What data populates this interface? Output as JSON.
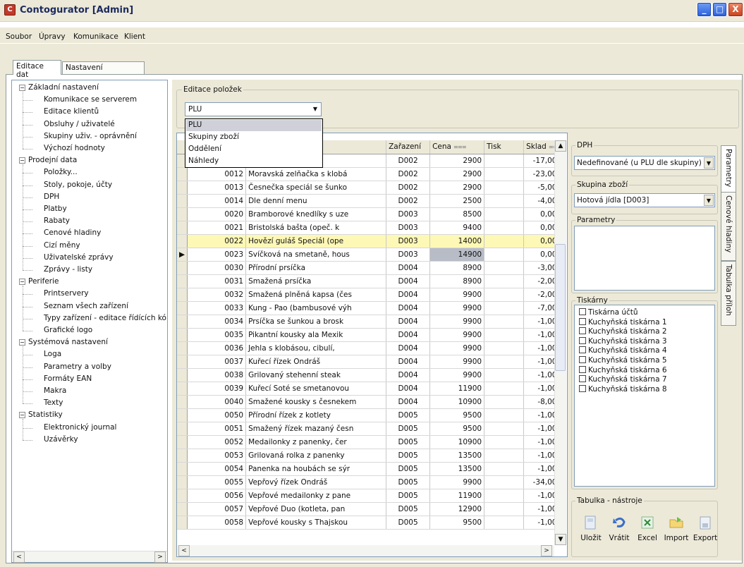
{
  "window": {
    "title": "Contogurator [Admin]",
    "buttons": [
      "_",
      "□",
      "X"
    ]
  },
  "menu": [
    "Soubor",
    "Úpravy",
    "Komunikace",
    "Klient"
  ],
  "tabs": [
    "Editace dat",
    "Nastavení programu"
  ],
  "tree": [
    {
      "label": "Základní nastavení",
      "level": 0
    },
    {
      "label": "Komunikace se serverem",
      "level": 1
    },
    {
      "label": "Editace klientů",
      "level": 1
    },
    {
      "label": "Obsluhy / uživatelé",
      "level": 1
    },
    {
      "label": "Skupiny uživ. - oprávnění",
      "level": 1
    },
    {
      "label": "Výchozí hodnoty",
      "level": 1
    },
    {
      "label": "Prodejní data",
      "level": 0
    },
    {
      "label": "Položky...",
      "level": 1
    },
    {
      "label": "Stoly, pokoje, účty",
      "level": 1
    },
    {
      "label": "DPH",
      "level": 1
    },
    {
      "label": "Platby",
      "level": 1
    },
    {
      "label": "Rabaty",
      "level": 1
    },
    {
      "label": "Cenové hladiny",
      "level": 1
    },
    {
      "label": "Cizí měny",
      "level": 1
    },
    {
      "label": "Uživatelské zprávy",
      "level": 1
    },
    {
      "label": "Zprávy - listy",
      "level": 1
    },
    {
      "label": "Periferie",
      "level": 0
    },
    {
      "label": "Printservery",
      "level": 1
    },
    {
      "label": "Seznam všech zařízení",
      "level": 1
    },
    {
      "label": "Typy zařízení - editace řídících kó",
      "level": 1
    },
    {
      "label": "Grafické logo",
      "level": 1
    },
    {
      "label": "Systémová nastavení",
      "level": 0
    },
    {
      "label": "Loga",
      "level": 1
    },
    {
      "label": "Parametry a volby",
      "level": 1
    },
    {
      "label": "Formáty EAN",
      "level": 1
    },
    {
      "label": "Makra",
      "level": 1
    },
    {
      "label": "Texty",
      "level": 1
    },
    {
      "label": "Statistiky",
      "level": 0
    },
    {
      "label": "Elektronický journal",
      "level": 1
    },
    {
      "label": "Uzávěrky",
      "level": 1
    }
  ],
  "edit": {
    "group_label": "Editace položek",
    "select_value": "PLU",
    "dropdown": [
      "PLU",
      "Skupiny zboží",
      "Oddělení",
      "Náhledy"
    ]
  },
  "grid": {
    "columns": [
      "",
      "",
      "",
      "Zařazení",
      "Cena",
      "Tisk",
      "Sklad"
    ],
    "rows": [
      [
        "",
        "ní a",
        "D002",
        "2900",
        "",
        "-17,000"
      ],
      [
        "0012",
        "Moravská zelňačka s klobá",
        "D002",
        "2900",
        "",
        "-23,000"
      ],
      [
        "0013",
        "Česnečka speciál se šunko",
        "D002",
        "2900",
        "",
        "-5,000"
      ],
      [
        "0014",
        "Dle denní menu",
        "D002",
        "2500",
        "",
        "-4,000"
      ],
      [
        "0020",
        "Bramborové knedlíky s uze",
        "D003",
        "8500",
        "",
        "0,000"
      ],
      [
        "0021",
        "Bristolská bašta (opeč. k",
        "D003",
        "9400",
        "",
        "0,000"
      ],
      [
        "0022",
        "Hovězí guláš Speciál (ope",
        "D003",
        "14000",
        "",
        "0,000"
      ],
      [
        "0023",
        "Svíčková na smetaně, hous",
        "D003",
        "14900",
        "",
        "0,000"
      ],
      [
        "0030",
        "Přírodní prsíčka",
        "D004",
        "8900",
        "",
        "-3,000"
      ],
      [
        "0031",
        "Smažená prsíčka",
        "D004",
        "8900",
        "",
        "-2,000"
      ],
      [
        "0032",
        "Smažená plněná kapsa (čes",
        "D004",
        "9900",
        "",
        "-2,000"
      ],
      [
        "0033",
        "Kung - Pao (bambusové výh",
        "D004",
        "9900",
        "",
        "-7,000"
      ],
      [
        "0034",
        "Prsíčka se šunkou a brosk",
        "D004",
        "9900",
        "",
        "-1,000"
      ],
      [
        "0035",
        "Pikantní kousky ala Mexik",
        "D004",
        "9900",
        "",
        "-1,000"
      ],
      [
        "0036",
        "Jehla s klobásou, cibulí,",
        "D004",
        "9900",
        "",
        "-1,000"
      ],
      [
        "0037",
        "Kuřecí řízek Ondráš",
        "D004",
        "9900",
        "",
        "-1,000"
      ],
      [
        "0038",
        "Grilovaný stehenní steak",
        "D004",
        "9900",
        "",
        "-1,000"
      ],
      [
        "0039",
        "Kuřecí Soté se smetanovou",
        "D004",
        "11900",
        "",
        "-1,000"
      ],
      [
        "0040",
        "Smažené kousky s česnekem",
        "D004",
        "10900",
        "",
        "-8,000"
      ],
      [
        "0050",
        "Přírodní řízek z kotlety",
        "D005",
        "9500",
        "",
        "-1,000"
      ],
      [
        "0051",
        "Smažený řízek mazaný česn",
        "D005",
        "9500",
        "",
        "-1,000"
      ],
      [
        "0052",
        "Medailonky z panenky, čer",
        "D005",
        "10900",
        "",
        "-1,000"
      ],
      [
        "0053",
        "Grilovaná rolka z panenky",
        "D005",
        "13500",
        "",
        "-1,000"
      ],
      [
        "0054",
        "Panenka na houbách se sýr",
        "D005",
        "13500",
        "",
        "-1,000"
      ],
      [
        "0055",
        "Vepřový řízek Ondráš",
        "D005",
        "9900",
        "",
        "-34,000"
      ],
      [
        "0056",
        "Vepřové medailonky z pane",
        "D005",
        "11900",
        "",
        "-1,000"
      ],
      [
        "0057",
        "Vepřové Duo (kotleta, pan",
        "D005",
        "12900",
        "",
        "-1,000"
      ],
      [
        "0058",
        "Vepřové kousky s Thajskou",
        "D005",
        "9500",
        "",
        "-1,000"
      ]
    ]
  },
  "right": {
    "dph_label": "DPH",
    "dph_value": "Nedefinované (u PLU dle skupiny)",
    "skupina_label": "Skupina zboží",
    "skupina_value": "Hotová jídla [D003]",
    "parametry_label": "Parametry",
    "tiskarny_label": "Tiskárny",
    "tiskarny": [
      "Tiskárna účtů",
      "Kuchyňská tiskárna 1",
      "Kuchyňská tiskárna 2",
      "Kuchyňská tiskárna 3",
      "Kuchyňská tiskárna 4",
      "Kuchyňská tiskárna 5",
      "Kuchyňská tiskárna 6",
      "Kuchyňská tiskárna 7",
      "Kuchyňská tiskárna 8"
    ],
    "tools_label": "Tabulka - nástroje",
    "tools": [
      "Uložit",
      "Vrátit",
      "Excel",
      "Import",
      "Export"
    ]
  },
  "side_tabs": [
    "Parametry",
    "Cenové hladiny",
    "Tabulka příloh"
  ]
}
